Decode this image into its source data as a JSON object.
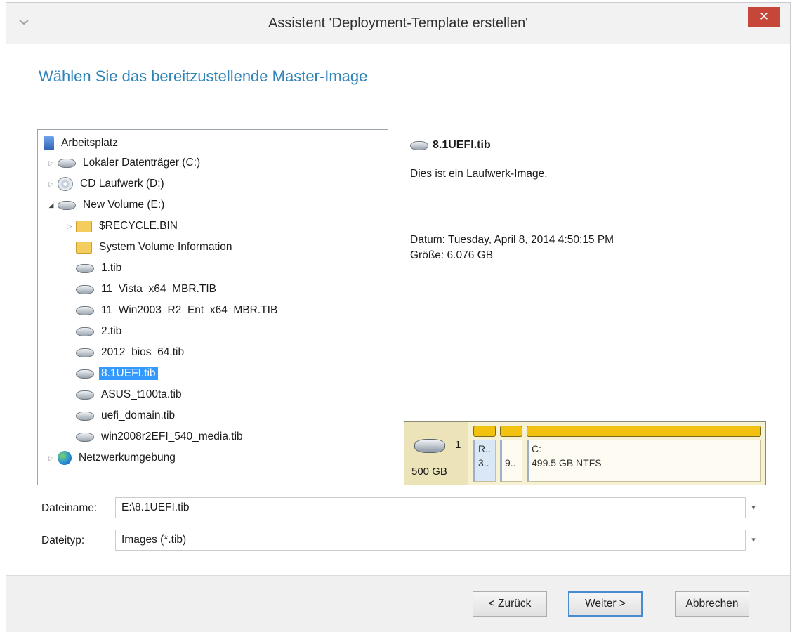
{
  "window": {
    "title": "Assistent 'Deployment-Template erstellen'",
    "close_glyph": "✕"
  },
  "heading": "Wählen Sie das bereitzustellende Master-Image",
  "tree": {
    "items": [
      {
        "label": "Arbeitsplatz",
        "icon": "computer-icon",
        "expander": ""
      },
      {
        "label": "Lokaler Datenträger (C:)",
        "icon": "drive-icon",
        "expander": "▷"
      },
      {
        "label": "CD Laufwerk (D:)",
        "icon": "cd-drive-icon",
        "expander": "▷"
      },
      {
        "label": "New Volume (E:)",
        "icon": "drive-icon",
        "expander": "◢"
      },
      {
        "label": "$RECYCLE.BIN",
        "icon": "folder-icon",
        "expander": "▷"
      },
      {
        "label": "System Volume Information",
        "icon": "folder-icon",
        "expander": ""
      },
      {
        "label": "1.tib",
        "icon": "image-file-icon",
        "expander": ""
      },
      {
        "label": "11_Vista_x64_MBR.TIB",
        "icon": "image-file-icon",
        "expander": ""
      },
      {
        "label": "11_Win2003_R2_Ent_x64_MBR.TIB",
        "icon": "image-file-icon",
        "expander": ""
      },
      {
        "label": "2.tib",
        "icon": "image-file-icon",
        "expander": ""
      },
      {
        "label": "2012_bios_64.tib",
        "icon": "image-file-icon",
        "expander": ""
      },
      {
        "label": "8.1UEFI.tib",
        "icon": "image-file-icon",
        "expander": "",
        "selected": true
      },
      {
        "label": "ASUS_t100ta.tib",
        "icon": "image-file-icon",
        "expander": ""
      },
      {
        "label": "uefi_domain.tib",
        "icon": "image-file-icon",
        "expander": ""
      },
      {
        "label": "win2008r2EFI_540_media.tib",
        "icon": "image-file-icon",
        "expander": ""
      },
      {
        "label": "Netzwerkumgebung",
        "icon": "network-icon",
        "expander": "▷"
      }
    ]
  },
  "info": {
    "name": "8.1UEFI.tib",
    "description": "Dies ist ein Laufwerk-Image.",
    "date": "Datum: Tuesday, April 8, 2014 4:50:15 PM",
    "size": "Größe: 6.076 GB"
  },
  "disk_map": {
    "disk_number": "1",
    "capacity": "500 GB",
    "partitions": [
      {
        "line1": "R..",
        "line2": "3.."
      },
      {
        "line1": "",
        "line2": "9.."
      },
      {
        "line1": "C:",
        "line2": "499.5 GB  NTFS"
      }
    ]
  },
  "fields": {
    "filename_label": "Dateiname:",
    "filename_value": "E:\\8.1UEFI.tib",
    "filetype_label": "Dateityp:",
    "filetype_value": "Images (*.tib)",
    "dropdown_glyph": "▾"
  },
  "buttons": {
    "back": "< Zurück",
    "next": "Weiter >",
    "cancel": "Abbrechen"
  }
}
